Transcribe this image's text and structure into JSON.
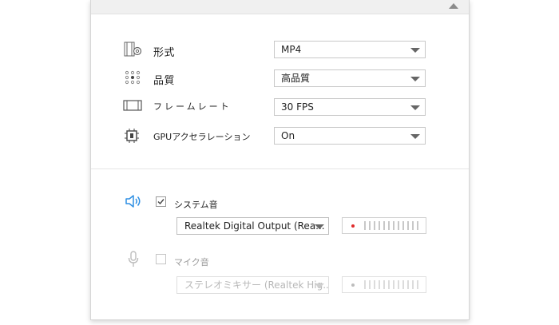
{
  "colors": {
    "speaker_icon": "#2f8fe3",
    "mic_icon": "#bdbdbd",
    "meter_active_dot": "#e02a2a",
    "meter_inactive_dot": "#bdbdbd"
  },
  "icons": {
    "collapse": "triangle-up-icon",
    "format": "film-gear-icon",
    "quality": "dots-grid-icon",
    "framerate": "film-strip-icon",
    "gpu": "chip-icon",
    "system_sound": "speaker-icon",
    "mic": "microphone-icon"
  },
  "settings": {
    "format": {
      "label": "形式",
      "value": "MP4"
    },
    "quality": {
      "label": "品質",
      "value": "高品質"
    },
    "framerate": {
      "label": "フレームレート",
      "value": "30 FPS"
    },
    "gpu": {
      "label": "GPUアクセラレーション",
      "value": "On"
    }
  },
  "audio": {
    "system": {
      "label": "システム音",
      "checked": true,
      "device": "Realtek Digital Output (Rea..."
    },
    "mic": {
      "label": "マイク音",
      "checked": false,
      "device": "ステレオミキサー (Realtek Hig..."
    }
  }
}
